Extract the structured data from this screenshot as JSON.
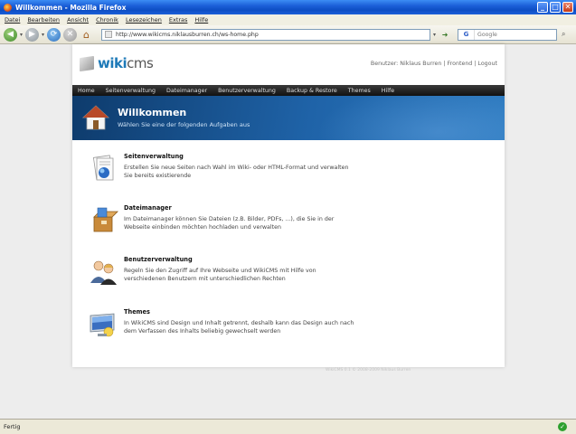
{
  "window": {
    "title": "Willkommen - Mozilla Firefox",
    "buttons": {
      "minimize": "_",
      "maximize": "□",
      "close": "✕"
    }
  },
  "menu": [
    "Datei",
    "Bearbeiten",
    "Ansicht",
    "Chronik",
    "Lesezeichen",
    "Extras",
    "Hilfe"
  ],
  "toolbar": {
    "url": "http://www.wikicms.niklausburren.ch/ws-home.php",
    "search_placeholder": "Google",
    "search_engine": "G"
  },
  "site": {
    "logo_prefix": "wiki",
    "logo_suffix": "cms",
    "user_info": "Benutzer: Niklaus Burren | Frontend | Logout",
    "nav": [
      "Home",
      "Seitenverwaltung",
      "Dateimanager",
      "Benutzerverwaltung",
      "Backup & Restore",
      "Themes",
      "Hilfe"
    ],
    "hero": {
      "title": "Willkommen",
      "subtitle": "Wählen Sie eine der folgenden Aufgaben aus"
    },
    "tasks": [
      {
        "title": "Seitenverwaltung",
        "description": "Erstellen Sie neue Seiten nach Wahl im Wiki- oder HTML-Format und verwalten Sie bereits existierende",
        "icon": "pages-icon"
      },
      {
        "title": "Dateimanager",
        "description": "Im Dateimanager können Sie Dateien (z.B. Bilder, PDFs, ...), die Sie in der Webseite einbinden möchten hochladen und verwalten",
        "icon": "box-icon"
      },
      {
        "title": "Benutzerverwaltung",
        "description": "Regeln Sie den Zugriff auf Ihre Webseite und WikiCMS mit Hilfe von verschiedenen Benutzern mit unterschiedlichen Rechten",
        "icon": "users-icon"
      },
      {
        "title": "Themes",
        "description": "In WikiCMS sind Design und Inhalt getrennt, deshalb kann das Design auch nach dem Verfassen des Inhalts beliebig gewechselt werden",
        "icon": "monitor-icon"
      }
    ],
    "footer": "WikiCMS 0.1 © 2008-2009 Niklaus Burren"
  },
  "status": {
    "text": "Fertig"
  }
}
